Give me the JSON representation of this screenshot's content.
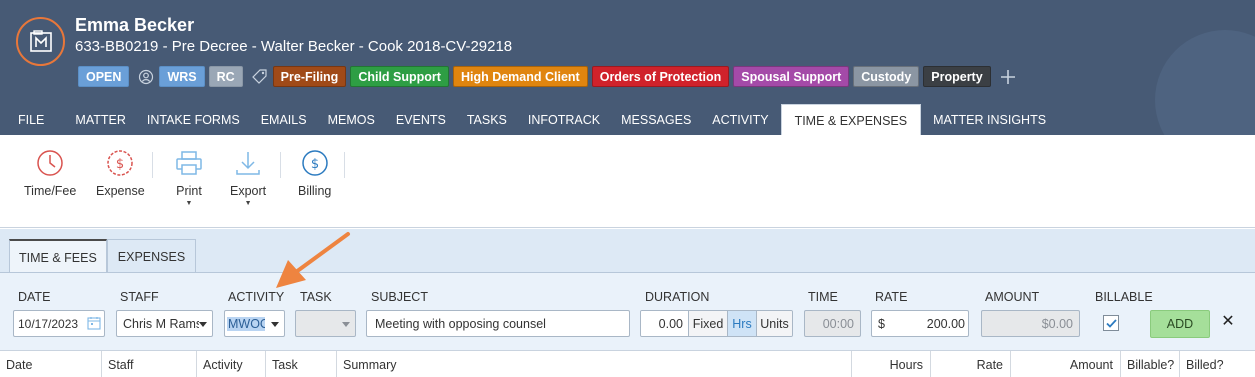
{
  "header": {
    "client_name": "Emma Becker",
    "matter_line": "633-BB0219 - Pre Decree - Walter Becker - Cook 2018-CV-29218",
    "status_badges": [
      {
        "label": "OPEN",
        "color": "#6a9fd8"
      },
      {
        "label": "WRS",
        "color": "#6a9fd8"
      },
      {
        "label": "RC",
        "color": "#9aa7b6"
      }
    ],
    "tags": [
      {
        "label": "Pre-Filing",
        "color": "#a04a18"
      },
      {
        "label": "Child Support",
        "color": "#2e9e44"
      },
      {
        "label": "High Demand Client",
        "color": "#e0850f"
      },
      {
        "label": "Orders of Protection",
        "color": "#d0222b"
      },
      {
        "label": "Spousal Support",
        "color": "#a44aa8"
      },
      {
        "label": "Custody",
        "color": "#8b96a3"
      },
      {
        "label": "Property",
        "color": "#3b3f44"
      }
    ],
    "accent_color": "#e8773a",
    "background_color": "#475a75"
  },
  "tabs": [
    {
      "label": "FILE",
      "active": false
    },
    {
      "label": "MATTER",
      "active": false
    },
    {
      "label": "INTAKE FORMS",
      "active": false
    },
    {
      "label": "EMAILS",
      "active": false
    },
    {
      "label": "MEMOS",
      "active": false
    },
    {
      "label": "EVENTS",
      "active": false
    },
    {
      "label": "TASKS",
      "active": false
    },
    {
      "label": "INFOTRACK",
      "active": false
    },
    {
      "label": "MESSAGES",
      "active": false
    },
    {
      "label": "ACTIVITY",
      "active": false
    },
    {
      "label": "TIME & EXPENSES",
      "active": true
    },
    {
      "label": "MATTER INSIGHTS",
      "active": false
    }
  ],
  "ribbon": {
    "time_fee": "Time/Fee",
    "expense": "Expense",
    "print": "Print",
    "export": "Export",
    "billing": "Billing"
  },
  "subtabs": [
    {
      "label": "TIME & FEES",
      "active": true
    },
    {
      "label": "EXPENSES",
      "active": false
    }
  ],
  "form": {
    "labels": {
      "date": "DATE",
      "staff": "STAFF",
      "activity": "ACTIVITY",
      "task": "TASK",
      "subject": "SUBJECT",
      "duration": "DURATION",
      "time": "TIME",
      "rate": "RATE",
      "amount": "AMOUNT",
      "billable": "BILLABLE"
    },
    "date_value": "10/17/2023",
    "staff_value": "Chris M Rams",
    "activity_value": "MWOC",
    "task_value": "",
    "subject_value": "Meeting with opposing counsel",
    "duration_value": "0.00",
    "duration_modes": [
      "Fixed",
      "Hrs",
      "Units"
    ],
    "duration_selected": "Hrs",
    "time_value": "00:00",
    "rate_currency": "$",
    "rate_value": "200.00",
    "amount_value": "$0.00",
    "billable_checked": true,
    "add_label": "ADD",
    "close_label": "✕"
  },
  "grid": {
    "columns": [
      "Date",
      "Staff",
      "Activity",
      "Task",
      "Summary",
      "Hours",
      "Rate",
      "Amount",
      "Billable?",
      "Billed?"
    ]
  }
}
